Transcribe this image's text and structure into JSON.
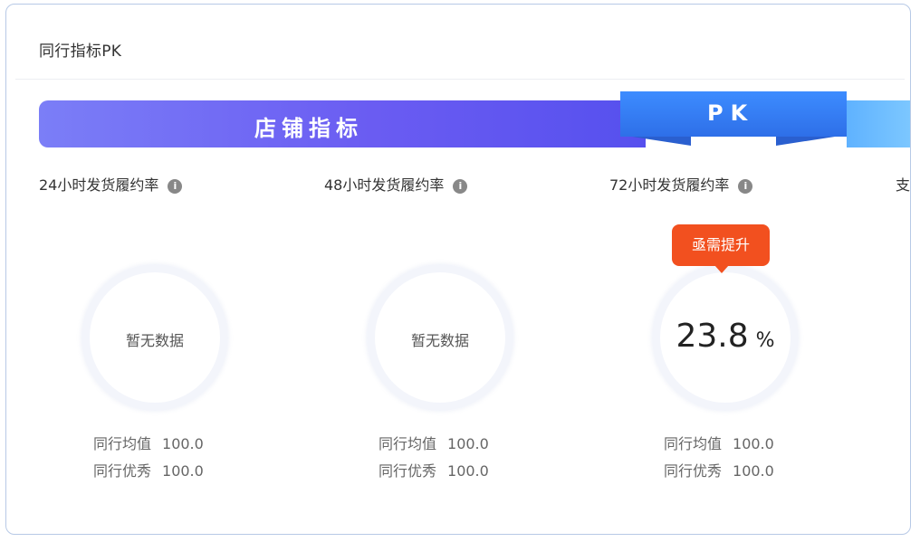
{
  "card": {
    "title": "同行指标PK"
  },
  "banner": {
    "label": "店铺指标",
    "pk_label": "PK"
  },
  "metrics": [
    {
      "label": "24小时发货履约率",
      "info_icon": "i",
      "ring_text": "暂无数据",
      "avg_label": "同行均值",
      "avg_value": "100.0",
      "best_label": "同行优秀",
      "best_value": "100.0"
    },
    {
      "label": "48小时发货履约率",
      "info_icon": "i",
      "ring_text": "暂无数据",
      "avg_label": "同行均值",
      "avg_value": "100.0",
      "best_label": "同行优秀",
      "best_value": "100.0"
    },
    {
      "label": "72小时发货履约率",
      "info_icon": "i",
      "value": "23.8",
      "unit": "%",
      "badge": "亟需提升",
      "avg_label": "同行均值",
      "avg_value": "100.0",
      "best_label": "同行优秀",
      "best_value": "100.0"
    }
  ],
  "partial_metric_label": "支",
  "colors": {
    "banner": "#6a5cf2",
    "pk": "#2e6fe8",
    "badge": "#f2501f",
    "border": "#b7c9e6"
  }
}
